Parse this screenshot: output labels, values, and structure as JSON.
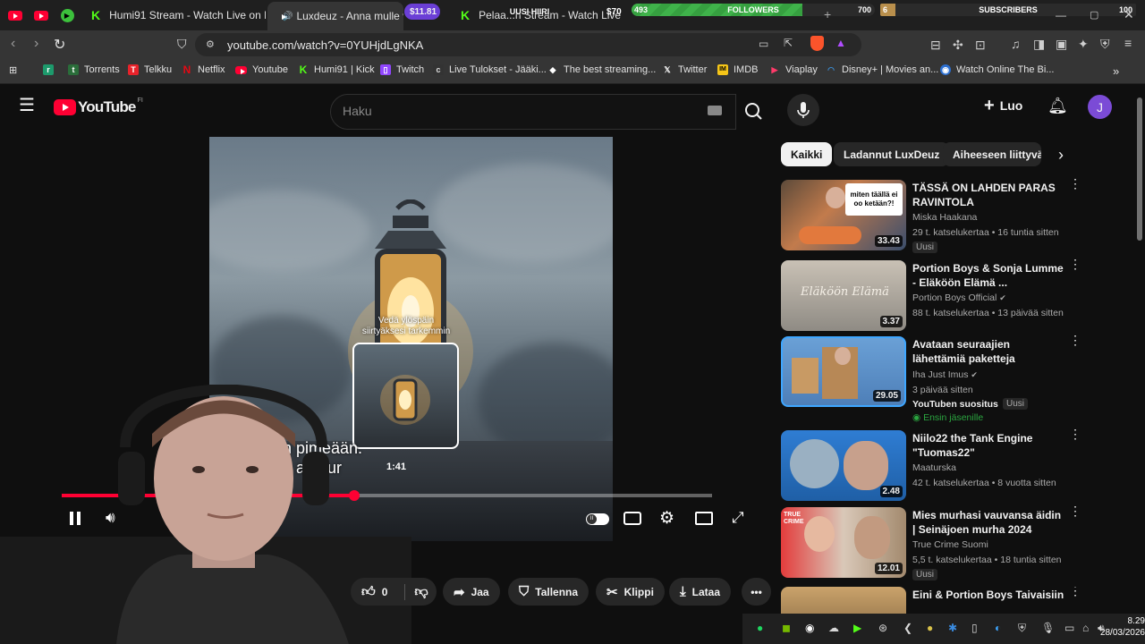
{
  "browser": {
    "tabs": [
      {
        "title": "Humi91 Stream - Watch Live on Kick"
      },
      {
        "title": "Luxdeuz - Anna mulle vii"
      },
      {
        "title": "Pelaa...h Stream - Watch Live"
      }
    ],
    "url": "youtube.com/watch?v=0YUHjdLgNKA",
    "bookmarks": [
      "Torrents",
      "Telkku",
      "Netflix",
      "Youtube",
      "Humi91 | Kick",
      "Twitch",
      "Live Tulokset - Jääki...",
      "The best streaming...",
      "Twitter",
      "IMDB",
      "Viaplay",
      "Disney+ | Movies an...",
      "Watch Online The Bi..."
    ]
  },
  "overlays": {
    "money_left": "$11.81",
    "uusi_hiiri": "UUSI HIIRI",
    "money_right": "$70",
    "followers_label": "FOLLOWERS",
    "followers_current": "493",
    "followers_goal": "700",
    "subscribers_label": "SUBSCRIBERS",
    "subscribers_current": "6",
    "subscribers_goal": "100",
    "followers_progress": 0.704,
    "subscribers_progress": 0.06
  },
  "youtube": {
    "country": "FI",
    "search_placeholder": "Haku",
    "create_label": "Luo",
    "avatar_letter": "J"
  },
  "player": {
    "scrub_hint": "Vedä ylöspäin siirtyäksesi tarkemmin",
    "preview_time": "1:41",
    "captions": [
      "n pimeään.",
      "e aamur"
    ],
    "progress": 0.45
  },
  "actions": {
    "likes": "0",
    "share": "Jaa",
    "save": "Tallenna",
    "clip": "Klippi",
    "download": "Lataa"
  },
  "chips": [
    "Kaikki",
    "Ladannut LuxDeuz",
    "Aiheeseen liittyvä"
  ],
  "videos": [
    {
      "title": "TÄSSÄ ON LAHDEN PARAS RAVINTOLA",
      "channel": "Miska Haakana",
      "meta": "29 t. katselukertaa • 16 tuntia sitten",
      "badge": "Uusi",
      "duration": "33.43",
      "thumb_text": "miten täällä ei oo ketään?!"
    },
    {
      "title": "Portion Boys & Sonja Lumme - Eläköön Elämä ...",
      "channel": "Portion Boys Official",
      "meta": "88 t. katselukertaa • 13 päivää sitten",
      "duration": "3.37",
      "thumb_text": "Eläköön Elämä"
    },
    {
      "title": "Avataan seuraajien lähettämiä paketteja",
      "channel": "Iha Just Imus",
      "meta": "3 päivää sitten",
      "recommended": "YouTuben suositus",
      "badge": "Uusi",
      "member": "Ensin jäsenille",
      "duration": "29.05"
    },
    {
      "title": "Niilo22 the Tank Engine \"Tuomas22\"",
      "channel": "Maaturska",
      "meta": "42 t. katselukertaa • 8 vuotta sitten",
      "duration": "2.48"
    },
    {
      "title": "Mies murhasi vauvansa äidin | Seinäjoen murha 2024",
      "channel": "True Crime Suomi",
      "meta": "5,5 t. katselukertaa • 18 tuntia sitten",
      "badge": "Uusi",
      "duration": "12.01",
      "thumb_text": "TRUE CRIME"
    },
    {
      "title": "Eini & Portion Boys Taivaisiin"
    }
  ],
  "taskbar": {
    "time": "8.29",
    "date": "28/03/2026"
  },
  "colors": {
    "yt_red": "#ff0033",
    "kick_green": "#53fc18",
    "bg": "#0f0f0f"
  }
}
